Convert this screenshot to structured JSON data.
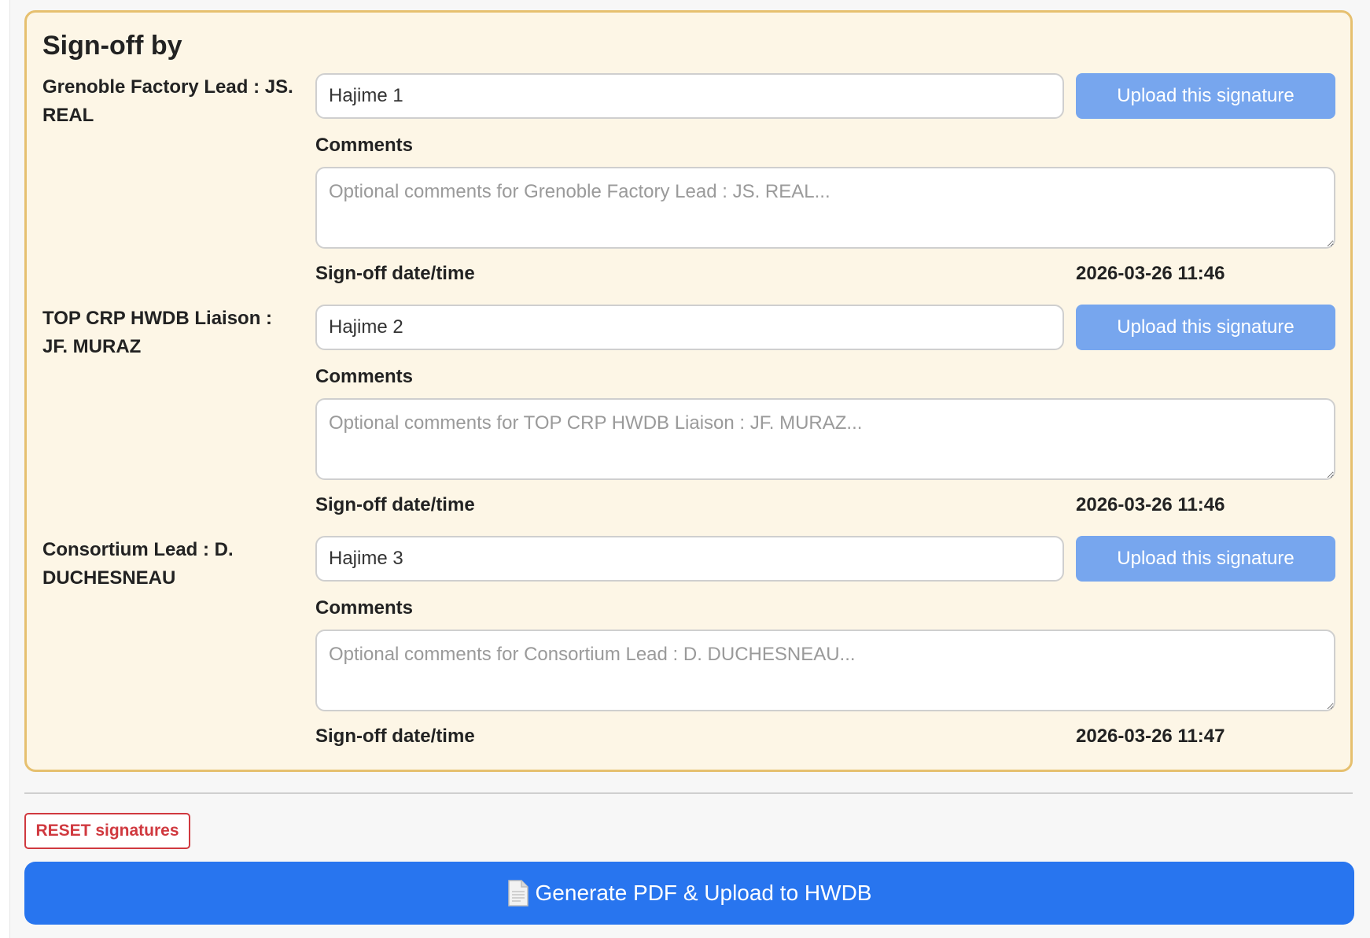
{
  "panel": {
    "title": "Sign-off by"
  },
  "signers": [
    {
      "name": "Grenoble Factory Lead : JS. REAL",
      "signature_value": "Hajime 1",
      "upload_label": "Upload this signature",
      "comments_label": "Comments",
      "comments_placeholder": "Optional comments for Grenoble Factory Lead : JS. REAL...",
      "date_label": "Sign-off date/time",
      "date_value": "2026-03-26 11:46"
    },
    {
      "name": "TOP CRP HWDB Liaison : JF. MURAZ",
      "signature_value": "Hajime 2",
      "upload_label": "Upload this signature",
      "comments_label": "Comments",
      "comments_placeholder": "Optional comments for TOP CRP HWDB Liaison : JF. MURAZ...",
      "date_label": "Sign-off date/time",
      "date_value": "2026-03-26 11:46"
    },
    {
      "name": "Consortium Lead : D. DUCHESNEAU",
      "signature_value": "Hajime 3",
      "upload_label": "Upload this signature",
      "comments_label": "Comments",
      "comments_placeholder": "Optional comments for Consortium Lead : D. DUCHESNEAU...",
      "date_label": "Sign-off date/time",
      "date_value": "2026-03-26 11:47"
    }
  ],
  "actions": {
    "reset_label": "RESET signatures",
    "generate_label": "Generate PDF & Upload to HWDB",
    "generate_icon": "document-icon"
  },
  "colors": {
    "panel_bg": "#fdf6e6",
    "panel_border": "#e6c06f",
    "upload_button": "#77a6ee",
    "generate_button": "#2875ef",
    "reset_accent": "#d0393f"
  }
}
